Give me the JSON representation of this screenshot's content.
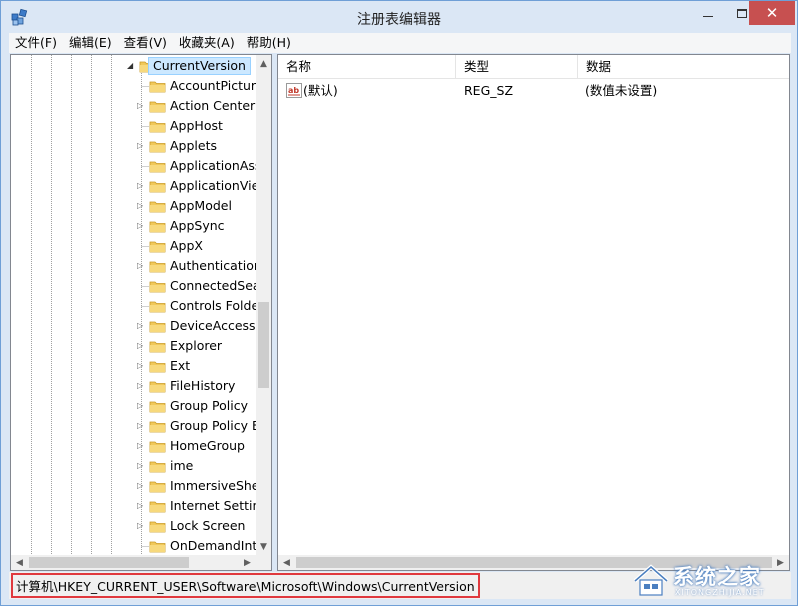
{
  "window": {
    "title": "注册表编辑器",
    "close_glyph": "✕"
  },
  "menu": [
    "文件(F)",
    "编辑(E)",
    "查看(V)",
    "收藏夹(A)",
    "帮助(H)"
  ],
  "tree": {
    "root": "CurrentVersion",
    "items": [
      {
        "label": "AccountPicture",
        "expandable": false
      },
      {
        "label": "Action Center",
        "expandable": true
      },
      {
        "label": "AppHost",
        "expandable": false
      },
      {
        "label": "Applets",
        "expandable": true
      },
      {
        "label": "ApplicationAss",
        "expandable": false
      },
      {
        "label": "ApplicationView",
        "expandable": true
      },
      {
        "label": "AppModel",
        "expandable": true
      },
      {
        "label": "AppSync",
        "expandable": true
      },
      {
        "label": "AppX",
        "expandable": false
      },
      {
        "label": "Authentication",
        "expandable": true
      },
      {
        "label": "ConnectedSear",
        "expandable": false
      },
      {
        "label": "Controls Folde",
        "expandable": false
      },
      {
        "label": "DeviceAccess",
        "expandable": true
      },
      {
        "label": "Explorer",
        "expandable": true
      },
      {
        "label": "Ext",
        "expandable": true
      },
      {
        "label": "FileHistory",
        "expandable": true
      },
      {
        "label": "Group Policy",
        "expandable": true
      },
      {
        "label": "Group Policy E",
        "expandable": true
      },
      {
        "label": "HomeGroup",
        "expandable": true
      },
      {
        "label": "ime",
        "expandable": true
      },
      {
        "label": "ImmersiveShel",
        "expandable": true
      },
      {
        "label": "Internet Setting",
        "expandable": true
      },
      {
        "label": "Lock Screen",
        "expandable": true
      },
      {
        "label": "OnDemandInte",
        "expandable": false
      }
    ]
  },
  "values": {
    "columns": [
      "名称",
      "类型",
      "数据"
    ],
    "rows": [
      {
        "name": "(默认)",
        "type": "REG_SZ",
        "data": "(数值未设置)",
        "icon": "string-value-icon"
      }
    ]
  },
  "status": {
    "path": "计算机\\HKEY_CURRENT_USER\\Software\\Microsoft\\Windows\\CurrentVersion"
  },
  "watermark": {
    "text": "系统之家",
    "sub": "XITONGZHIJIA.NET"
  },
  "colors": {
    "frame": "#dbe7f5",
    "selection": "#cce8ff",
    "highlight_border": "#e0393e",
    "close_button": "#c75050"
  }
}
